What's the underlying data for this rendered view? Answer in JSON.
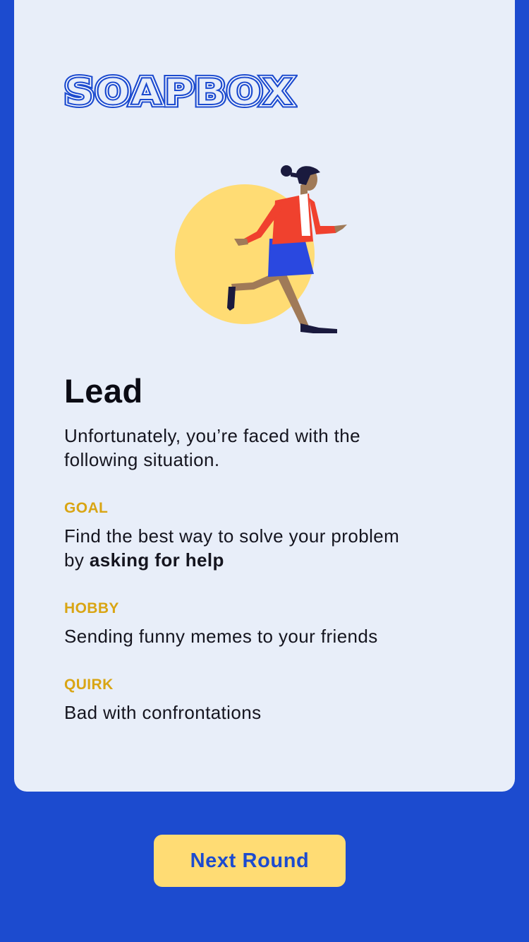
{
  "app": {
    "logo_text": "SOAPBOX"
  },
  "role": {
    "title": "Lead",
    "intro_line1": "Unfortunately, you’re faced with the",
    "intro_line2": "following situation."
  },
  "goal": {
    "label": "GOAL",
    "line1": "Find the best way to solve your problem",
    "line2_prefix": "by ",
    "line2_bold": "asking for help"
  },
  "hobby": {
    "label": "HOBBY",
    "text": "Sending funny memes to your friends"
  },
  "quirk": {
    "label": "QUIRK",
    "text": "Bad with confrontations"
  },
  "actions": {
    "next_label": "Next Round"
  },
  "colors": {
    "background": "#1c4bcf",
    "card": "#e8eef9",
    "accent_label": "#d9a514",
    "button": "#ffdc74",
    "sun": "#ffdc74"
  },
  "icons": {
    "illustration": "running-woman-illustration"
  }
}
